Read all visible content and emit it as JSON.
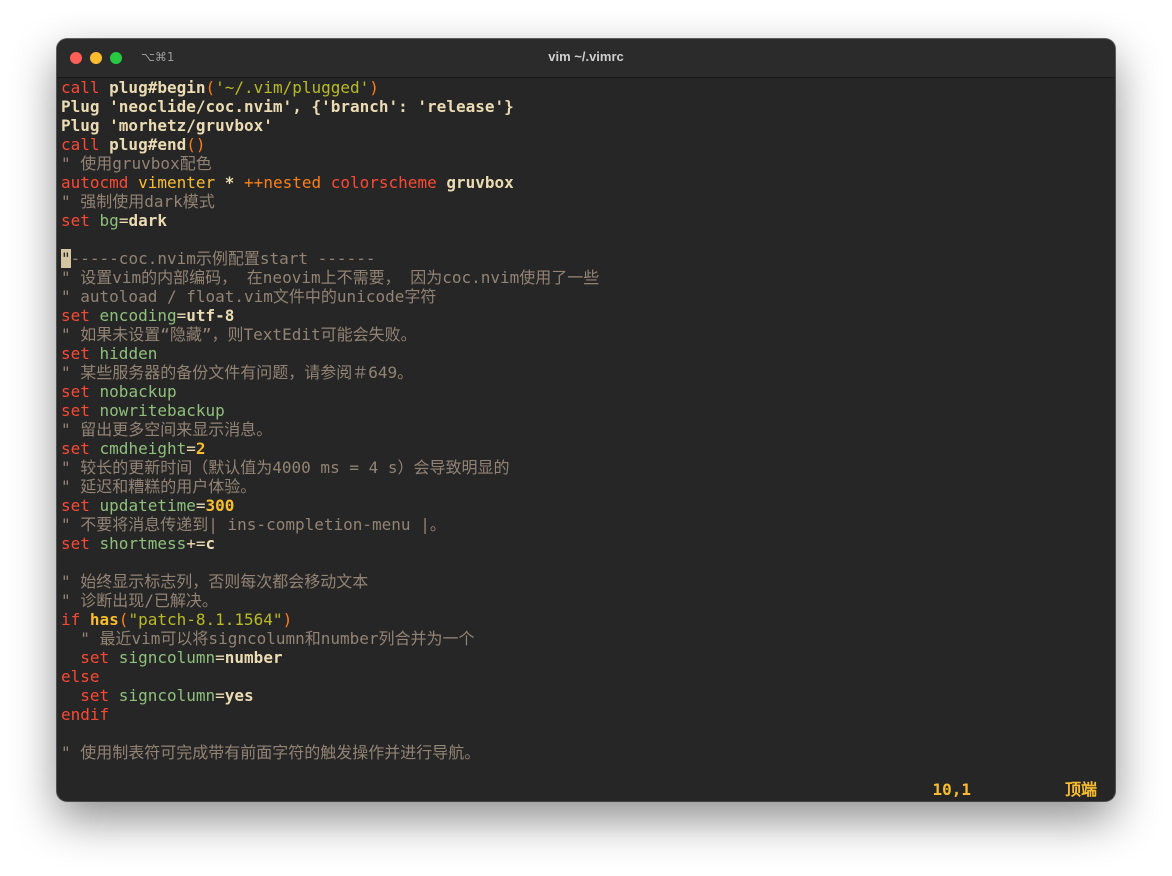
{
  "window": {
    "title": "vim ~/.vimrc",
    "shortcut": "⌥⌘1"
  },
  "code": {
    "l1": {
      "a": "call",
      "b": " plug#begin",
      "c": "(",
      "d": "'~/.vim/plugged'",
      "e": ")"
    },
    "l2": {
      "a": "Plug 'neoclide/coc.nvim', {'branch': 'release'}"
    },
    "l3": {
      "a": "Plug 'morhetz/gruvbox'"
    },
    "l4": {
      "a": "call",
      "b": " plug#end",
      "c": "()"
    },
    "l5": "\" 使用gruvbox配色",
    "l6": {
      "a": "autocmd",
      "b": " vimenter",
      "c": " * ",
      "d": "++nested",
      "e": " colorscheme",
      "f": " gruvbox"
    },
    "l7": "\" 强制使用dark模式",
    "l8": {
      "a": "set",
      "b": " bg",
      "c": "=",
      "d": "dark"
    },
    "l9": "",
    "l10": {
      "cursor": "\"",
      "rest": "-----coc.nvim示例配置start ------"
    },
    "l11": "\" 设置vim的内部编码， 在neovim上不需要， 因为coc.nvim使用了一些",
    "l12": "\" autoload / float.vim文件中的unicode字符",
    "l13": {
      "a": "set",
      "b": " encoding",
      "c": "=",
      "d": "utf-8"
    },
    "l14": "\" 如果未设置“隐藏”，则TextEdit可能会失败。",
    "l15": {
      "a": "set",
      "b": " hidden"
    },
    "l16": "\" 某些服务器的备份文件有问题，请参阅＃649。",
    "l17": {
      "a": "set",
      "b": " nobackup"
    },
    "l18": {
      "a": "set",
      "b": " nowritebackup"
    },
    "l19": "\" 留出更多空间来显示消息。",
    "l20": {
      "a": "set",
      "b": " cmdheight",
      "c": "=",
      "d": "2"
    },
    "l21": "\" 较长的更新时间（默认值为4000 ms = 4 s）会导致明显的",
    "l22": "\" 延迟和糟糕的用户体验。",
    "l23": {
      "a": "set",
      "b": " updatetime",
      "c": "=",
      "d": "300"
    },
    "l24": "\" 不要将消息传递到| ins-completion-menu |。",
    "l25": {
      "a": "set",
      "b": " shortmess",
      "c": "+=",
      "d": "c"
    },
    "l26": "",
    "l27": "\" 始终显示标志列，否则每次都会移动文本",
    "l28": "\" 诊断出现/已解决。",
    "l29": {
      "a": "if",
      "b": " has",
      "c": "(",
      "d": "\"patch-8.1.1564\"",
      "e": ")"
    },
    "l30": "  \" 最近vim可以将signcolumn和number列合并为一个",
    "l31": {
      "a": "  set",
      "b": " signcolumn",
      "c": "=",
      "d": "number"
    },
    "l32": "else",
    "l33": {
      "a": "  set",
      "b": " signcolumn",
      "c": "=",
      "d": "yes"
    },
    "l34": "endif",
    "l35": "",
    "l36": "\" 使用制表符可完成带有前面字符的触发操作并进行导航。"
  },
  "status": {
    "position": "10,1",
    "scroll": "顶端"
  }
}
